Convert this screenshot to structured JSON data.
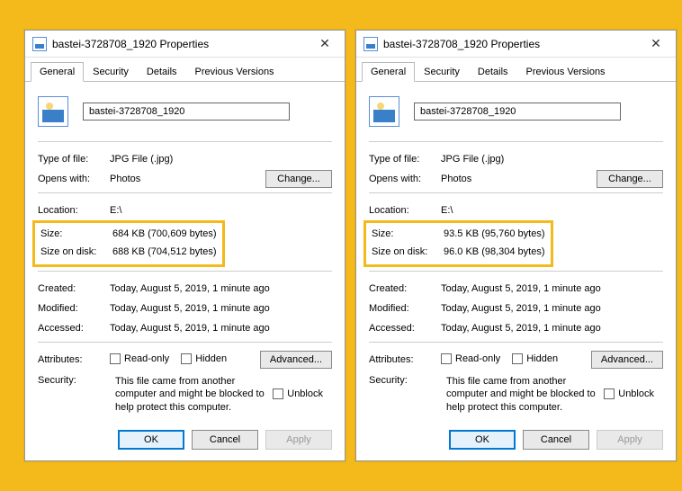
{
  "dialogs": [
    {
      "title": "bastei-3728708_1920 Properties",
      "tabs": [
        "General",
        "Security",
        "Details",
        "Previous Versions"
      ],
      "filename": "bastei-3728708_1920",
      "type_label": "Type of file:",
      "type_value": "JPG File (.jpg)",
      "opens_label": "Opens with:",
      "opens_value": "Photos",
      "change_btn": "Change...",
      "location_label": "Location:",
      "location_value": "E:\\",
      "size_label": "Size:",
      "size_value": "684 KB (700,609 bytes)",
      "sod_label": "Size on disk:",
      "sod_value": "688 KB (704,512 bytes)",
      "created_label": "Created:",
      "created_value": "Today, August 5, 2019, 1 minute ago",
      "modified_label": "Modified:",
      "modified_value": "Today, August 5, 2019, 1 minute ago",
      "accessed_label": "Accessed:",
      "accessed_value": "Today, August 5, 2019, 1 minute ago",
      "attr_label": "Attributes:",
      "readonly_label": "Read-only",
      "hidden_label": "Hidden",
      "advanced_btn": "Advanced...",
      "security_label": "Security:",
      "security_text": "This file came from another computer and might be blocked to help protect this computer.",
      "unblock_label": "Unblock",
      "ok": "OK",
      "cancel": "Cancel",
      "apply": "Apply"
    },
    {
      "title": "bastei-3728708_1920 Properties",
      "tabs": [
        "General",
        "Security",
        "Details",
        "Previous Versions"
      ],
      "filename": "bastei-3728708_1920",
      "type_label": "Type of file:",
      "type_value": "JPG File (.jpg)",
      "opens_label": "Opens with:",
      "opens_value": "Photos",
      "change_btn": "Change...",
      "location_label": "Location:",
      "location_value": "E:\\",
      "size_label": "Size:",
      "size_value": "93.5 KB (95,760 bytes)",
      "sod_label": "Size on disk:",
      "sod_value": "96.0 KB (98,304 bytes)",
      "created_label": "Created:",
      "created_value": "Today, August 5, 2019, 1 minute ago",
      "modified_label": "Modified:",
      "modified_value": "Today, August 5, 2019, 1 minute ago",
      "accessed_label": "Accessed:",
      "accessed_value": "Today, August 5, 2019, 1 minute ago",
      "attr_label": "Attributes:",
      "readonly_label": "Read-only",
      "hidden_label": "Hidden",
      "advanced_btn": "Advanced...",
      "security_label": "Security:",
      "security_text": "This file came from another computer and might be blocked to help protect this computer.",
      "unblock_label": "Unblock",
      "ok": "OK",
      "cancel": "Cancel",
      "apply": "Apply"
    }
  ]
}
